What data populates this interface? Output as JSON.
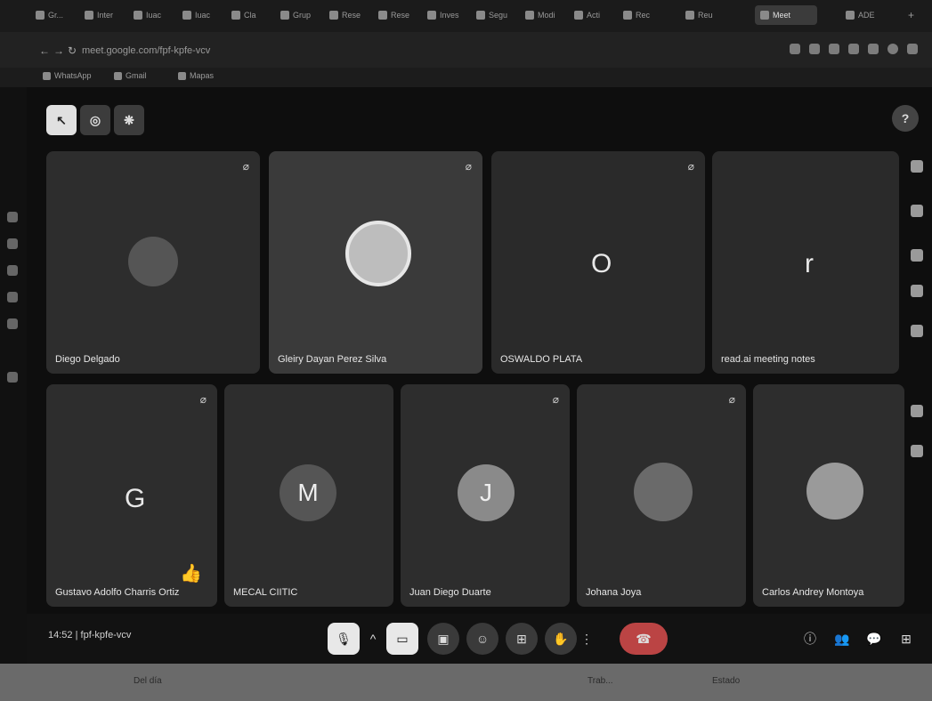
{
  "browser": {
    "tabs": [
      {
        "label": "Gr..."
      },
      {
        "label": "Inter"
      },
      {
        "label": "Iuac"
      },
      {
        "label": "Iuac"
      },
      {
        "label": "Cla"
      },
      {
        "label": "Grup"
      },
      {
        "label": "Rese"
      },
      {
        "label": "Rese"
      },
      {
        "label": "Inves"
      },
      {
        "label": "Segu"
      },
      {
        "label": "Modi"
      },
      {
        "label": "Acti"
      },
      {
        "label": "Rec"
      },
      {
        "label": "Reu"
      },
      {
        "label": "Meet"
      },
      {
        "label": "ADE"
      }
    ],
    "url": "meet.google.com/fpf-kpfe-vcv",
    "bookmarks": [
      "WhatsApp",
      "Gmail",
      "Mapas"
    ]
  },
  "meet": {
    "participants_row1": [
      {
        "name": "Diego Delgado"
      },
      {
        "name": "Gleiry Dayan Perez Silva"
      },
      {
        "name": "OSWALDO PLATA",
        "initial": "O"
      },
      {
        "name": "read.ai meeting notes",
        "initial": "r"
      }
    ],
    "participants_row2": [
      {
        "name": "Gustavo Adolfo Charris Ortiz",
        "initial": "G"
      },
      {
        "name": "MECAL CIITIC",
        "initial": "M"
      },
      {
        "name": "Juan Diego Duarte",
        "initial": "J"
      },
      {
        "name": "Johana Joya"
      },
      {
        "name": "Carlos Andrey Montoya"
      }
    ],
    "time": "14:52",
    "meeting_code": "fpf-kpfe-vcv",
    "separator": "|",
    "reaction_icon": "👍"
  },
  "taskbar": {
    "items": [
      "Del día",
      "Trab...",
      "Estado"
    ]
  },
  "colors": {
    "tile_bg": "#2d2d2d",
    "end_call": "#b44444",
    "page_bg": "#0e0e0e"
  }
}
